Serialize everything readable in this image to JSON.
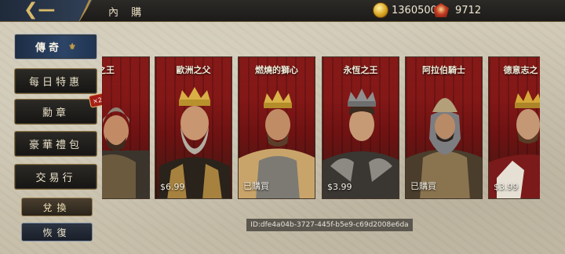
{
  "header": {
    "back_icon": "back-arrow-icon",
    "title": "內 購",
    "gold_amount": "1360500",
    "gold_icon": "gold-coin-icon",
    "gem_amount": "9712",
    "gem_icon": "red-gem-icon"
  },
  "sidebar": {
    "items": [
      {
        "label": "傳奇",
        "active": true
      },
      {
        "label": "每日特惠",
        "active": false
      },
      {
        "label": "勳章",
        "active": false,
        "badge": "×2"
      },
      {
        "label": "豪華禮包",
        "active": false
      },
      {
        "label": "交易行",
        "active": false
      }
    ],
    "exchange_label": "兌換",
    "restore_label": "恢復"
  },
  "cards": [
    {
      "name": "人之王",
      "status": ""
    },
    {
      "name": "歐洲之父",
      "status": "$6.99"
    },
    {
      "name": "燃燒的獅心",
      "status": "已購買"
    },
    {
      "name": "永恆之王",
      "status": "$3.99"
    },
    {
      "name": "阿拉伯騎士",
      "status": "已購買"
    },
    {
      "name": "德意志之",
      "status": "$3.99"
    }
  ],
  "footer": {
    "id_text": "ID:dfe4a04b-3727-445f-b5e9-c69d2008e6da"
  },
  "colors": {
    "accent_gold": "#c49a4a",
    "banner_red": "#8b1a18",
    "active_tab_blue": "#2c4466"
  }
}
